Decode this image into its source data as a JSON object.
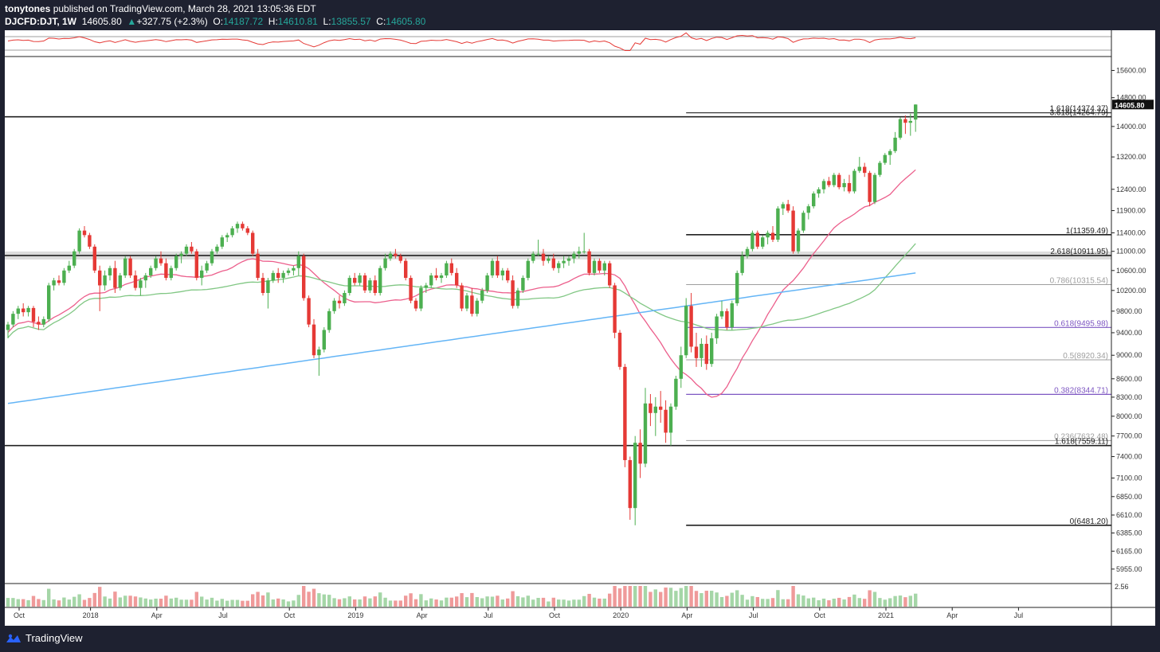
{
  "header": {
    "author": "tonytones",
    "published_text": "published on TradingView.com, March 28, 2021 13:05:36 EDT",
    "symbol": "DJCFD:DJT, 1W",
    "last": "14605.80",
    "arrow": "▲",
    "change": "+327.75 (+2.3%)",
    "o_label": "O:",
    "o_val": "14187.72",
    "h_label": "H:",
    "h_val": "14610.81",
    "l_label": "L:",
    "l_val": "13855.57",
    "c_label": "C:",
    "c_val": "14605.80"
  },
  "footer": {
    "brand": "TradingView"
  },
  "colors": {
    "up": "#4caf50",
    "down": "#e53935",
    "sma_fast": "#ec5f8c",
    "sma_mid": "#81c784",
    "sma_slow": "#64b5f6",
    "rsi": "#e53935",
    "fib_purple": "#7e57c2",
    "fib_gray": "#9e9e9e"
  },
  "chart_data": {
    "type": "candlestick",
    "timeframe": "1W",
    "y_scale": "log",
    "ylim": [
      5800,
      16000
    ],
    "y_ticks": [
      "15600.00",
      "14800.00",
      "14000.00",
      "13200.00",
      "12400.00",
      "11900.00",
      "11400.00",
      "11000.00",
      "10600.00",
      "10200.00",
      "9800.00",
      "9400.00",
      "9000.00",
      "8600.00",
      "8300.00",
      "8000.00",
      "7700.00",
      "7400.00",
      "7100.00",
      "6850.00",
      "6610.00",
      "6385.00",
      "6165.00",
      "5955.00"
    ],
    "last_price_label": "14605.80",
    "x_ticks": [
      "Oct",
      "2018",
      "Apr",
      "Jul",
      "Oct",
      "2019",
      "Apr",
      "Jul",
      "Oct",
      "2020",
      "Apr",
      "Jul",
      "Oct",
      "2021",
      "Apr",
      "Jul"
    ],
    "volume_scale_label": "2.56",
    "candles": [
      [
        9450,
        9600,
        9300,
        9550
      ],
      [
        9550,
        9800,
        9500,
        9750
      ],
      [
        9750,
        9900,
        9650,
        9850
      ],
      [
        9850,
        9950,
        9700,
        9780
      ],
      [
        9780,
        9900,
        9700,
        9860
      ],
      [
        9860,
        9900,
        9500,
        9600
      ],
      [
        9600,
        9700,
        9450,
        9550
      ],
      [
        9550,
        9700,
        9500,
        9650
      ],
      [
        9650,
        10350,
        9600,
        10300
      ],
      [
        10300,
        10450,
        10200,
        10400
      ],
      [
        10400,
        10500,
        10300,
        10350
      ],
      [
        10350,
        10650,
        10300,
        10600
      ],
      [
        10600,
        10800,
        10550,
        10700
      ],
      [
        10700,
        11050,
        10650,
        11000
      ],
      [
        11000,
        11500,
        10950,
        11450
      ],
      [
        11450,
        11550,
        11300,
        11350
      ],
      [
        11350,
        11400,
        11050,
        11100
      ],
      [
        11100,
        11150,
        10550,
        10600
      ],
      [
        10600,
        10700,
        9800,
        10300
      ],
      [
        10300,
        10600,
        10200,
        10500
      ],
      [
        10500,
        10700,
        10400,
        10650
      ],
      [
        10650,
        10800,
        10150,
        10250
      ],
      [
        10250,
        10550,
        10200,
        10500
      ],
      [
        10500,
        10900,
        10450,
        10850
      ],
      [
        10850,
        10900,
        10450,
        10500
      ],
      [
        10500,
        10600,
        10200,
        10250
      ],
      [
        10250,
        10450,
        10100,
        10400
      ],
      [
        10400,
        10550,
        10250,
        10500
      ],
      [
        10500,
        10700,
        10450,
        10650
      ],
      [
        10650,
        10900,
        10600,
        10850
      ],
      [
        10850,
        11000,
        10700,
        10750
      ],
      [
        10750,
        10850,
        10400,
        10450
      ],
      [
        10450,
        10700,
        10400,
        10650
      ],
      [
        10650,
        10950,
        10600,
        10900
      ],
      [
        10900,
        11000,
        10750,
        10950
      ],
      [
        10950,
        11150,
        10900,
        11100
      ],
      [
        11100,
        11200,
        10950,
        11000
      ],
      [
        11000,
        11050,
        10400,
        10450
      ],
      [
        10450,
        10700,
        10300,
        10600
      ],
      [
        10600,
        10800,
        10550,
        10750
      ],
      [
        10750,
        11050,
        10700,
        11000
      ],
      [
        11000,
        11150,
        10950,
        11100
      ],
      [
        11100,
        11350,
        11050,
        11300
      ],
      [
        11300,
        11400,
        11200,
        11350
      ],
      [
        11350,
        11550,
        11300,
        11500
      ],
      [
        11500,
        11650,
        11400,
        11600
      ],
      [
        11600,
        11650,
        11450,
        11500
      ],
      [
        11500,
        11550,
        11350,
        11400
      ],
      [
        11400,
        11450,
        10900,
        10950
      ],
      [
        10950,
        11050,
        10400,
        10450
      ],
      [
        10450,
        10550,
        10100,
        10150
      ],
      [
        10150,
        10450,
        9850,
        10400
      ],
      [
        10400,
        10600,
        10350,
        10550
      ],
      [
        10550,
        10650,
        10350,
        10450
      ],
      [
        10450,
        10600,
        10350,
        10550
      ],
      [
        10550,
        10650,
        10500,
        10600
      ],
      [
        10600,
        10700,
        10500,
        10650
      ],
      [
        10650,
        11000,
        10500,
        10900
      ],
      [
        10900,
        10950,
        10000,
        10050
      ],
      [
        10050,
        10100,
        9500,
        9550
      ],
      [
        9550,
        9650,
        8950,
        9000
      ],
      [
        9000,
        9150,
        8650,
        9100
      ],
      [
        9100,
        9500,
        9050,
        9450
      ],
      [
        9450,
        9850,
        9400,
        9800
      ],
      [
        9800,
        10050,
        9750,
        10000
      ],
      [
        10000,
        10100,
        9850,
        9950
      ],
      [
        9950,
        10200,
        9900,
        10150
      ],
      [
        10150,
        10500,
        10100,
        10450
      ],
      [
        10450,
        10550,
        10300,
        10350
      ],
      [
        10350,
        10550,
        10300,
        10500
      ],
      [
        10500,
        10550,
        10150,
        10200
      ],
      [
        10200,
        10450,
        10150,
        10400
      ],
      [
        10400,
        10500,
        10100,
        10150
      ],
      [
        10150,
        10700,
        10100,
        10650
      ],
      [
        10650,
        10950,
        10600,
        10850
      ],
      [
        10850,
        11000,
        10800,
        10950
      ],
      [
        10950,
        11050,
        10850,
        10900
      ],
      [
        10900,
        10950,
        10750,
        10800
      ],
      [
        10800,
        10850,
        10400,
        10450
      ],
      [
        10450,
        10500,
        9950,
        10000
      ],
      [
        10000,
        10050,
        9800,
        9850
      ],
      [
        9850,
        10300,
        9800,
        10250
      ],
      [
        10250,
        10350,
        10150,
        10300
      ],
      [
        10300,
        10550,
        10250,
        10500
      ],
      [
        10500,
        10650,
        10400,
        10450
      ],
      [
        10450,
        10550,
        10350,
        10500
      ],
      [
        10500,
        10800,
        10450,
        10750
      ],
      [
        10750,
        10850,
        10500,
        10550
      ],
      [
        10550,
        10650,
        10250,
        10300
      ],
      [
        10300,
        10350,
        9800,
        9850
      ],
      [
        9850,
        10150,
        9800,
        10100
      ],
      [
        10100,
        10250,
        9700,
        9750
      ],
      [
        9750,
        10050,
        9700,
        10000
      ],
      [
        10000,
        10250,
        9950,
        10200
      ],
      [
        10200,
        10550,
        10150,
        10500
      ],
      [
        10500,
        10850,
        10450,
        10800
      ],
      [
        10800,
        10900,
        10450,
        10500
      ],
      [
        10500,
        10650,
        10400,
        10600
      ],
      [
        10600,
        10650,
        10350,
        10400
      ],
      [
        10400,
        10500,
        9850,
        9900
      ],
      [
        9900,
        10250,
        9850,
        10200
      ],
      [
        10200,
        10500,
        10150,
        10450
      ],
      [
        10450,
        10850,
        10400,
        10800
      ],
      [
        10800,
        11000,
        10750,
        10950
      ],
      [
        10950,
        11250,
        10900,
        10950
      ],
      [
        10950,
        11050,
        10700,
        10800
      ],
      [
        10800,
        10900,
        10750,
        10850
      ],
      [
        10850,
        10950,
        10600,
        10650
      ],
      [
        10650,
        10800,
        10550,
        10750
      ],
      [
        10750,
        10900,
        10650,
        10800
      ],
      [
        10800,
        10900,
        10700,
        10850
      ],
      [
        10850,
        11000,
        10750,
        10950
      ],
      [
        10950,
        11100,
        10850,
        11000
      ],
      [
        11000,
        11400,
        10950,
        11000
      ],
      [
        11000,
        11050,
        10500,
        10550
      ],
      [
        10550,
        10850,
        10500,
        10800
      ],
      [
        10800,
        10850,
        10550,
        10600
      ],
      [
        10600,
        10800,
        10500,
        10750
      ],
      [
        10750,
        10800,
        10250,
        10300
      ],
      [
        10300,
        10350,
        9300,
        9400
      ],
      [
        9400,
        9450,
        8750,
        8800
      ],
      [
        8800,
        8850,
        7250,
        7350
      ],
      [
        7350,
        7400,
        6550,
        6700
      ],
      [
        6700,
        7700,
        6481,
        7600
      ],
      [
        7600,
        7800,
        7100,
        7300
      ],
      [
        7300,
        8450,
        7250,
        8200
      ],
      [
        8200,
        8350,
        7850,
        8050
      ],
      [
        8050,
        8300,
        7700,
        8150
      ],
      [
        8150,
        8400,
        7900,
        8100
      ],
      [
        8100,
        8250,
        7600,
        7750
      ],
      [
        7750,
        8200,
        7559,
        8150
      ],
      [
        8150,
        8650,
        8100,
        8600
      ],
      [
        8600,
        9150,
        8450,
        9000
      ],
      [
        9000,
        10050,
        8950,
        9900
      ],
      [
        9900,
        10150,
        9050,
        9150
      ],
      [
        9150,
        9400,
        8800,
        8950
      ],
      [
        8950,
        9300,
        8800,
        9200
      ],
      [
        9200,
        9350,
        8750,
        8850
      ],
      [
        8850,
        9400,
        8800,
        9300
      ],
      [
        9300,
        9750,
        9200,
        9700
      ],
      [
        9700,
        10000,
        9650,
        9800
      ],
      [
        9800,
        9850,
        9450,
        9500
      ],
      [
        9500,
        10000,
        9450,
        9950
      ],
      [
        9950,
        10600,
        9900,
        10550
      ],
      [
        10550,
        11000,
        10500,
        10900
      ],
      [
        10900,
        11100,
        10850,
        11050
      ],
      [
        11050,
        11450,
        11000,
        11400
      ],
      [
        11400,
        11450,
        11050,
        11100
      ],
      [
        11100,
        11350,
        11050,
        11300
      ],
      [
        11300,
        11450,
        11150,
        11400
      ],
      [
        11400,
        11550,
        11200,
        11250
      ],
      [
        11250,
        12000,
        11200,
        11950
      ],
      [
        11950,
        12100,
        11800,
        12050
      ],
      [
        12050,
        12150,
        11850,
        11900
      ],
      [
        11900,
        12000,
        10950,
        11000
      ],
      [
        11000,
        11500,
        10950,
        11450
      ],
      [
        11450,
        11900,
        11400,
        11850
      ],
      [
        11850,
        12050,
        11700,
        12000
      ],
      [
        12000,
        12350,
        11950,
        12300
      ],
      [
        12300,
        12450,
        12200,
        12400
      ],
      [
        12400,
        12650,
        12300,
        12600
      ],
      [
        12600,
        12700,
        12450,
        12500
      ],
      [
        12500,
        12800,
        12450,
        12750
      ],
      [
        12750,
        12800,
        12400,
        12450
      ],
      [
        12450,
        12650,
        12350,
        12550
      ],
      [
        12550,
        12750,
        12300,
        12350
      ],
      [
        12350,
        12900,
        12300,
        12850
      ],
      [
        12850,
        13200,
        12800,
        12950
      ],
      [
        12950,
        13050,
        12700,
        12800
      ],
      [
        12800,
        12850,
        12000,
        12100
      ],
      [
        12100,
        12800,
        12050,
        12750
      ],
      [
        12750,
        13100,
        12700,
        13050
      ],
      [
        13050,
        13300,
        13000,
        13250
      ],
      [
        13250,
        13400,
        13000,
        13350
      ],
      [
        13350,
        13850,
        13300,
        13700
      ],
      [
        13700,
        14250,
        13650,
        14200
      ],
      [
        14200,
        14300,
        13800,
        14100
      ],
      [
        14100,
        14350,
        13750,
        14150
      ],
      [
        14187.72,
        14610.81,
        13855.57,
        14605.8
      ]
    ],
    "indicators": [
      {
        "name": "SMA fast",
        "color": "sma_fast"
      },
      {
        "name": "SMA mid",
        "color": "sma_mid"
      },
      {
        "name": "SMA slow",
        "color": "sma_slow"
      },
      {
        "name": "RSI",
        "color": "rsi"
      }
    ],
    "horizontal_levels": [
      {
        "value": 14264.79,
        "label": "3.618(14264.79)",
        "style": "long"
      },
      {
        "value": 14374.37,
        "label": "1.618(14374.37)",
        "style": "fib"
      },
      {
        "value": 11359.49,
        "label": "1(11359.49)",
        "style": "fib-black"
      },
      {
        "value": 10911.95,
        "label": "2.618(10911.95)",
        "style": "long-zone"
      },
      {
        "value": 10315.54,
        "label": "0.786(10315.54)",
        "style": "fib-gray"
      },
      {
        "value": 9495.98,
        "label": "0.618(9495.98)",
        "style": "fib-purple"
      },
      {
        "value": 8920.34,
        "label": "0.5(8920.34)",
        "style": "fib-gray"
      },
      {
        "value": 8344.71,
        "label": "0.382(8344.71)",
        "style": "fib-purple"
      },
      {
        "value": 7632.48,
        "label": "0.236(7632.48)",
        "style": "fib-gray"
      },
      {
        "value": 7559.11,
        "label": "1.618(7559.11)",
        "style": "long"
      },
      {
        "value": 6481.2,
        "label": "0(6481.20)",
        "style": "fib-black"
      }
    ]
  }
}
